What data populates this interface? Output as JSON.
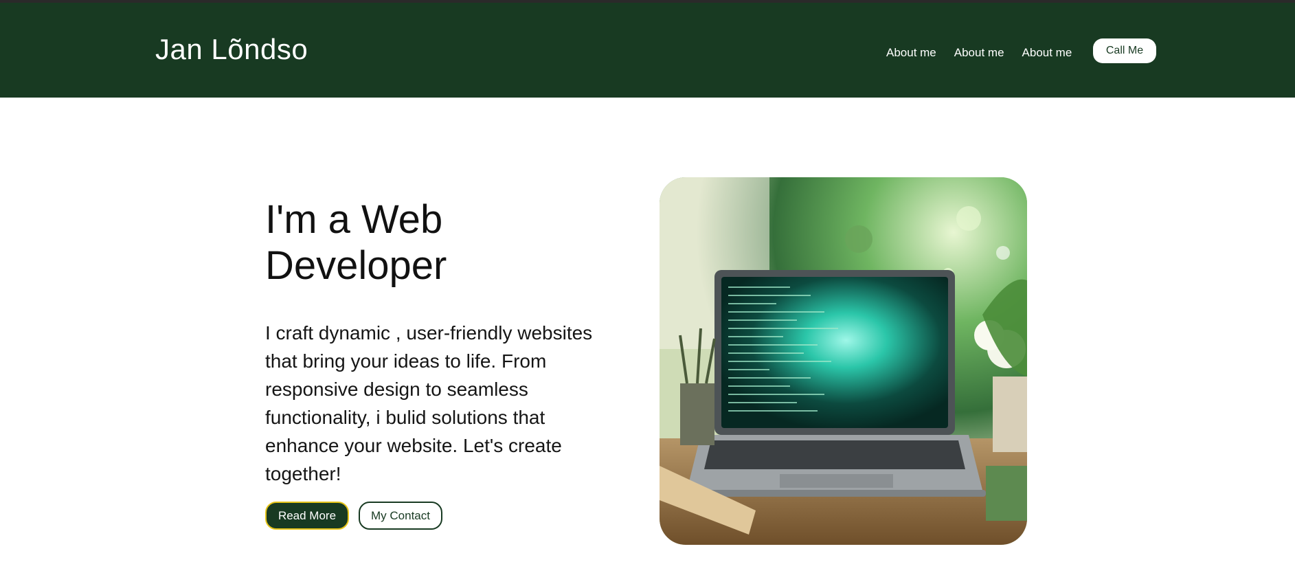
{
  "header": {
    "logo": "Jan Lõndso",
    "nav": [
      {
        "label": "About me"
      },
      {
        "label": "About me"
      },
      {
        "label": "About me"
      }
    ],
    "cta_label": "Call Me"
  },
  "hero": {
    "title": "I'm a Web Developer",
    "description": "I craft dynamic , user-friendly websites that bring your ideas to life. From responsive design to seamless functionality, i bulid solutions that enhance your website. Let's create together!",
    "primary_button": "Read More",
    "secondary_button": "My Contact"
  },
  "colors": {
    "brand": "#183a22",
    "accent": "#e6c419"
  }
}
